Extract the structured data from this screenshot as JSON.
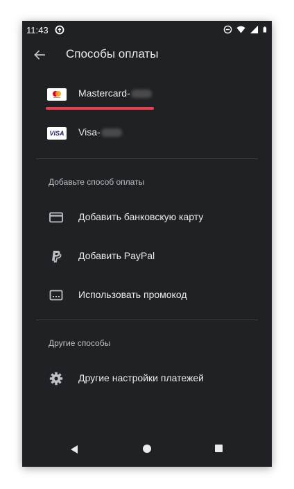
{
  "status_bar": {
    "time": "11:43"
  },
  "app_bar": {
    "title": "Способы оплаты"
  },
  "payment_methods": [
    {
      "label": "Mastercard-",
      "card_icon": "mastercard-icon"
    },
    {
      "label": "Visa-",
      "card_icon": "visa-card-icon",
      "card_text": "VISA"
    }
  ],
  "add_section": {
    "header": "Добавьте способ оплаты",
    "items": [
      {
        "label": "Добавить банковскую карту",
        "icon": "credit-card-icon"
      },
      {
        "label": "Добавить PayPal",
        "icon": "paypal-icon"
      },
      {
        "label": "Использовать промокод",
        "icon": "promo-code-icon"
      }
    ]
  },
  "other_section": {
    "header": "Другие способы",
    "items": [
      {
        "label": "Другие настройки платежей",
        "icon": "gear-icon"
      }
    ]
  },
  "colors": {
    "background": "#202124",
    "text_primary": "#e8eaed",
    "text_secondary": "#bdc1c6",
    "highlight_underline": "#e8404f"
  }
}
